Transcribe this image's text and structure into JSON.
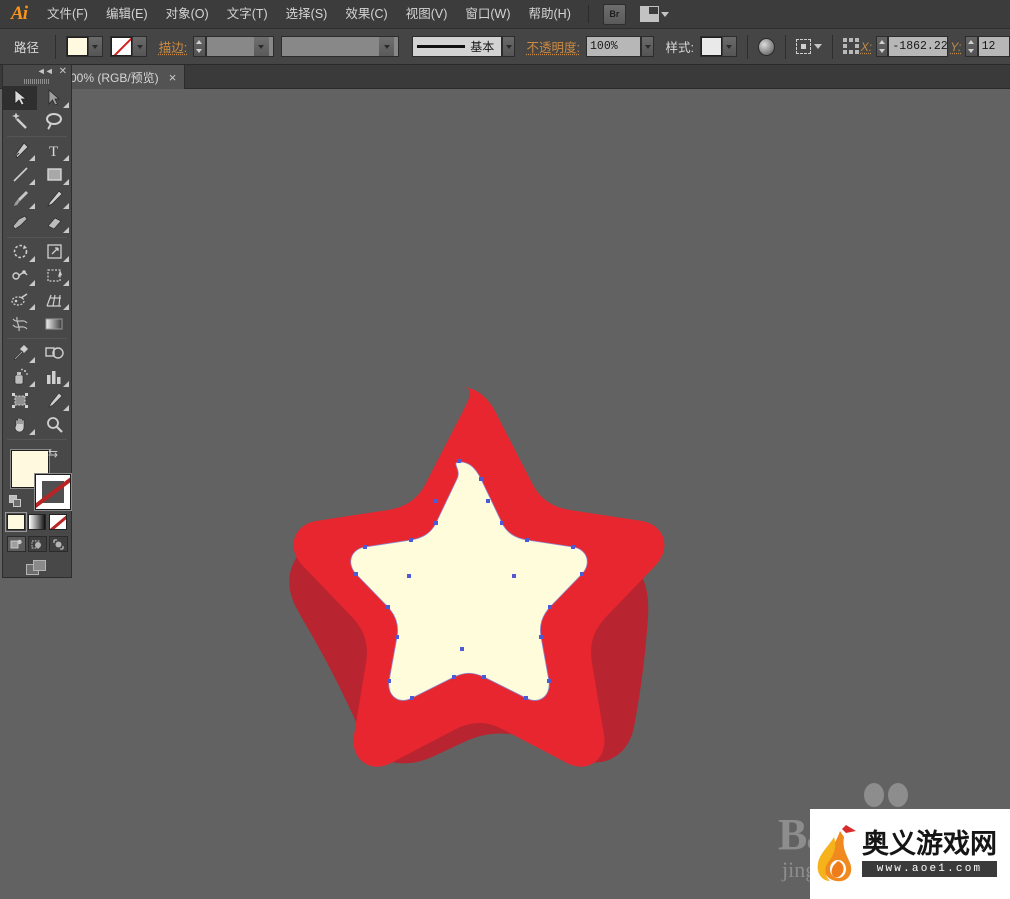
{
  "app": {
    "name": "Adobe Illustrator",
    "logo_text": "Ai"
  },
  "menubar": {
    "items": [
      {
        "label": "文件(F)",
        "name": "menu-file"
      },
      {
        "label": "编辑(E)",
        "name": "menu-edit"
      },
      {
        "label": "对象(O)",
        "name": "menu-object"
      },
      {
        "label": "文字(T)",
        "name": "menu-type"
      },
      {
        "label": "选择(S)",
        "name": "menu-select"
      },
      {
        "label": "效果(C)",
        "name": "menu-effect"
      },
      {
        "label": "视图(V)",
        "name": "menu-view"
      },
      {
        "label": "窗口(W)",
        "name": "menu-window"
      },
      {
        "label": "帮助(H)",
        "name": "menu-help"
      }
    ],
    "bridge_button": "Br",
    "arrange_documents_icon": "arrange-documents-icon"
  },
  "controlbar": {
    "selection_label": "路径",
    "fill_label": "fill-swatch",
    "fill_color": "#FFFADF",
    "stroke_swatch_label": "stroke-swatch",
    "stroke_value": "none",
    "stroke_weight_label": "描边:",
    "stroke_weight_value": "",
    "variable_width_value": "",
    "brush_definition_value": "基本",
    "opacity_label": "不透明度:",
    "opacity_value": "100%",
    "style_label": "样式:",
    "recolor_artwork_icon": "recolor-artwork-icon",
    "align_icon": "align-icon",
    "transform_icon": "transform-panel-icon",
    "x_label": "X:",
    "x_value": "-1862.22",
    "y_label": "Y:",
    "y_value": "12"
  },
  "tabbar": {
    "document_tab_label": "00% (RGB/预览)",
    "close_glyph": "×"
  },
  "toolpanel": {
    "collapse_glyph": "◄◄",
    "close_glyph": "✕",
    "tools": [
      {
        "name": "selection-tool",
        "label": "选择工具",
        "active": true
      },
      {
        "name": "direct-selection-tool",
        "label": "直接选择工具",
        "active": false
      },
      {
        "name": "magic-wand-tool",
        "label": "魔棒工具",
        "active": false
      },
      {
        "name": "lasso-tool",
        "label": "套索工具",
        "active": false
      },
      {
        "name": "pen-tool",
        "label": "钢笔工具",
        "active": false
      },
      {
        "name": "type-tool",
        "label": "文字工具",
        "active": false
      },
      {
        "name": "line-segment-tool",
        "label": "直线段工具",
        "active": false
      },
      {
        "name": "rectangle-tool",
        "label": "矩形工具",
        "active": false
      },
      {
        "name": "paintbrush-tool",
        "label": "画笔工具",
        "active": false
      },
      {
        "name": "pencil-tool",
        "label": "铅笔工具",
        "active": false
      },
      {
        "name": "blob-brush-tool",
        "label": "斑点画笔工具",
        "active": false
      },
      {
        "name": "eraser-tool",
        "label": "橡皮擦工具",
        "active": false
      },
      {
        "name": "rotate-tool",
        "label": "旋转工具",
        "active": false
      },
      {
        "name": "scale-tool",
        "label": "比例缩放工具",
        "active": false
      },
      {
        "name": "width-tool",
        "label": "宽度工具",
        "active": false
      },
      {
        "name": "free-transform-tool",
        "label": "自由变换工具",
        "active": false
      },
      {
        "name": "shape-builder-tool",
        "label": "形状生成器工具",
        "active": false
      },
      {
        "name": "perspective-grid-tool",
        "label": "透视网格工具",
        "active": false
      },
      {
        "name": "mesh-tool",
        "label": "网格工具",
        "active": false
      },
      {
        "name": "gradient-tool",
        "label": "渐变工具",
        "active": false
      },
      {
        "name": "eyedropper-tool",
        "label": "吸管工具",
        "active": false
      },
      {
        "name": "blend-tool",
        "label": "混合工具",
        "active": false
      },
      {
        "name": "symbol-sprayer-tool",
        "label": "符号喷枪工具",
        "active": false
      },
      {
        "name": "column-graph-tool",
        "label": "柱形图工具",
        "active": false
      },
      {
        "name": "artboard-tool",
        "label": "画板工具",
        "active": false
      },
      {
        "name": "slice-tool",
        "label": "切片工具",
        "active": false
      },
      {
        "name": "hand-tool",
        "label": "抓手工具",
        "active": false
      },
      {
        "name": "zoom-tool",
        "label": "缩放工具",
        "active": false
      }
    ],
    "fill_color": "#FFFADF",
    "stroke_color": "none",
    "swap_icon": "swap-fill-stroke-icon",
    "default_icon": "default-fill-stroke-icon",
    "modes": [
      {
        "name": "color-mode",
        "label": "颜色",
        "selected": true
      },
      {
        "name": "gradient-mode",
        "label": "渐变",
        "selected": false
      },
      {
        "name": "none-mode",
        "label": "无",
        "selected": false
      }
    ],
    "draw_modes": [
      {
        "name": "draw-normal-mode",
        "label": "正常绘图",
        "selected": true
      },
      {
        "name": "draw-behind-mode",
        "label": "背面绘图",
        "selected": false
      },
      {
        "name": "draw-inside-mode",
        "label": "内部绘图",
        "selected": false
      }
    ],
    "screen_mode": "change-screen-mode-icon"
  },
  "canvas": {
    "background_color": "#626262",
    "artwork": {
      "name": "rounded-star-illustration",
      "body_color": "#E8262F",
      "shadow_color": "#B8242F",
      "inner_star_color": "#FFFCDC",
      "anchor_point_color": "#4C5BD4",
      "selected_path": "inner-star-path"
    }
  },
  "watermarks": {
    "baidu": {
      "name": "baidu-watermark",
      "text": "Ba",
      "subtext": "jing"
    },
    "aoe": {
      "name": "aoe-watermark",
      "site_name": "奥义游戏网",
      "url": "www.aoe1.com"
    }
  }
}
